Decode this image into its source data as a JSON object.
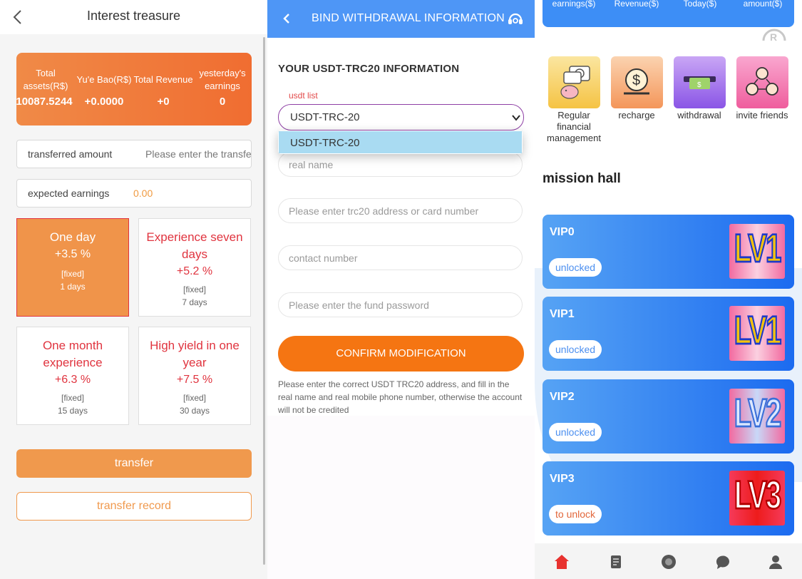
{
  "left": {
    "title": "Interest treasure",
    "stats": [
      {
        "label": "Total assets(R$)",
        "value": "10087.5244"
      },
      {
        "label": "Yu'e Bao(R$)",
        "value": "+0.0000"
      },
      {
        "label": "Total Revenue",
        "value": "+0"
      },
      {
        "label": "yesterday's earnings",
        "value": "0"
      }
    ],
    "transfer_field": {
      "label": "transferred amount",
      "placeholder": "Please enter the transfer amount"
    },
    "expected_field": {
      "label": "expected earnings",
      "value": "0.00"
    },
    "plans": [
      {
        "name": "One day",
        "rate": "+3.5 %",
        "fixed": "[fixed]",
        "days": "1 days",
        "selected": true
      },
      {
        "name": "Experience seven days",
        "rate": "+5.2 %",
        "fixed": "[fixed]",
        "days": "7 days",
        "selected": false
      },
      {
        "name": "One month experience",
        "rate": "+6.3 %",
        "fixed": "[fixed]",
        "days": "15 days",
        "selected": false
      },
      {
        "name": "High yield in one year",
        "rate": "+7.5 %",
        "fixed": "[fixed]",
        "days": "30 days",
        "selected": false
      }
    ],
    "transfer_button": "transfer",
    "record_button": "transfer record"
  },
  "middle": {
    "header_title": "BIND WITHDRAWAL INFORMATION",
    "section_title": "YOUR USDT-TRC20 INFORMATION",
    "usdt_label": "usdt list",
    "selected_network": "USDT-TRC-20",
    "dropdown_options": [
      "USDT-TRC-20"
    ],
    "real_name_placeholder": "real name",
    "address_placeholder": "Please enter trc20 address or card number",
    "contact_placeholder": "contact number",
    "fund_password_placeholder": "Please enter the fund password",
    "confirm_button": "CONFIRM MODIFICATION",
    "note": "Please enter the correct USDT TRC20 address, and fill in the real name and real mobile phone number, otherwise the account will not be credited"
  },
  "right": {
    "top_stats": [
      "yesterday's earnings($)",
      "Total Revenue($)",
      "Earnings Today($)",
      "frozen amount($)"
    ],
    "quick_actions": [
      {
        "label": "Regular financial management",
        "icon": "money-piggy-icon"
      },
      {
        "label": "recharge",
        "icon": "dollar-coin-icon"
      },
      {
        "label": "withdrawal",
        "icon": "atm-cash-icon"
      },
      {
        "label": "invite friends",
        "icon": "people-network-icon"
      }
    ],
    "mission_title": "mission hall",
    "vips": [
      {
        "name": "VIP0",
        "status": "unlocked",
        "level": "LV1"
      },
      {
        "name": "VIP1",
        "status": "unlocked",
        "level": "LV1"
      },
      {
        "name": "VIP2",
        "status": "unlocked",
        "level": "LV2"
      },
      {
        "name": "VIP3",
        "status": "to unlock",
        "level": "LV3"
      }
    ],
    "nav_icons": [
      "home-icon",
      "orders-icon",
      "service-icon",
      "messages-icon",
      "profile-icon"
    ]
  },
  "colors": {
    "orange": "#f0944a",
    "blue": "#4e96f6",
    "confirm_orange": "#f57512",
    "red_text": "#e0343f"
  }
}
